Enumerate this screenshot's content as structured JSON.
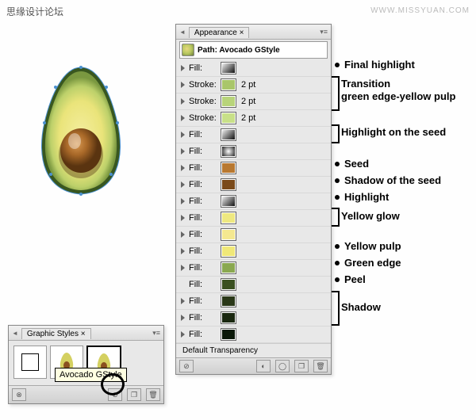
{
  "labels": {
    "corner": "思缘设计论坛",
    "url": "WWW.MISSYUAN.COM"
  },
  "gstyles": {
    "title": "Graphic Styles",
    "tooltip": "Avocado GStyle"
  },
  "appearance": {
    "title": "Appearance",
    "path": "Path: Avocado GStyle",
    "defaultTrans": "Default Transparency",
    "rows": [
      {
        "label": "Fill:",
        "swatch": "grad-diag",
        "val": "",
        "anno": "Final highlight"
      },
      {
        "label": "Stroke:",
        "swatch": "#a9c66a",
        "val": "2 pt",
        "anno": "transition"
      },
      {
        "label": "Stroke:",
        "swatch": "#b8d47a",
        "val": "2 pt",
        "anno": "transition"
      },
      {
        "label": "Stroke:",
        "swatch": "#c8e088",
        "val": "2 pt",
        "anno": "transition"
      },
      {
        "label": "Fill:",
        "swatch": "grad-diag",
        "val": "",
        "anno": "Highlight on the seed"
      },
      {
        "label": "Fill:",
        "swatch": "grad-rad",
        "val": "",
        "anno": "seedspec"
      },
      {
        "label": "Fill:",
        "swatch": "#b87830",
        "val": "",
        "anno": "Seed"
      },
      {
        "label": "Fill:",
        "swatch": "#7a4a1a",
        "val": "",
        "anno": "Shadow of the seed"
      },
      {
        "label": "Fill:",
        "swatch": "grad-diag",
        "val": "",
        "anno": "Highlight"
      },
      {
        "label": "Fill:",
        "swatch": "#eee880",
        "val": "",
        "anno": "yellowglow"
      },
      {
        "label": "Fill:",
        "swatch": "#f4e890",
        "val": "",
        "anno": "yellowglow"
      },
      {
        "label": "Fill:",
        "swatch": "#f0e878",
        "val": "",
        "anno": "Yellow pulp"
      },
      {
        "label": "Fill:",
        "swatch": "#8aa850",
        "val": "",
        "anno": "Green edge"
      },
      {
        "label": "Fill:",
        "swatch": "#3a5020",
        "val": "",
        "anno": "Peel",
        "noTri": true
      },
      {
        "label": "Fill:",
        "swatch": "#2a3818",
        "val": "",
        "anno": "shadow"
      },
      {
        "label": "Fill:",
        "swatch": "#1a2810",
        "val": "",
        "anno": "shadow"
      },
      {
        "label": "Fill:",
        "swatch": "#0a1808",
        "val": "",
        "anno": "shadow"
      }
    ]
  },
  "annotations": {
    "a1": "Final highlight",
    "a2a": "Transition",
    "a2b": "green edge-yellow pulp",
    "a3": "Highlight on the seed",
    "a4": "Seed",
    "a5": "Shadow of the seed",
    "a6": "Highlight",
    "a7": "Yellow glow",
    "a8": "Yellow pulp",
    "a9": "Green edge",
    "a10": "Peel",
    "a11": "Shadow"
  }
}
